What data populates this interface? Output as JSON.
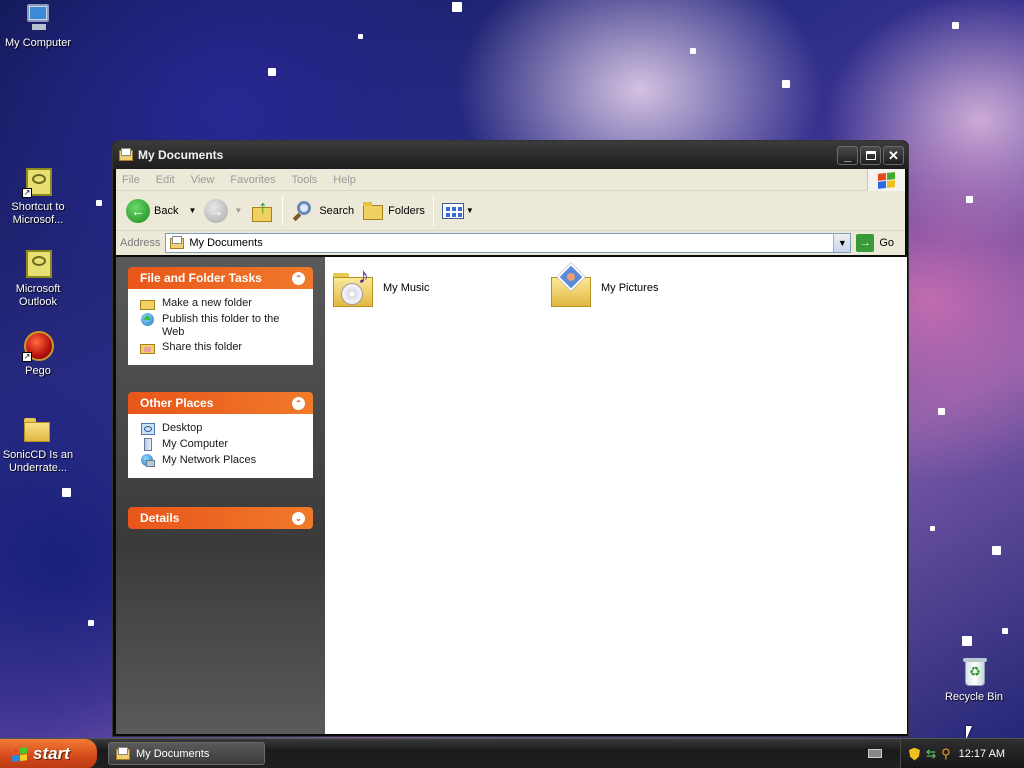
{
  "desktop": {
    "icons": [
      {
        "label": "My Computer",
        "icon": "my-computer-icon"
      },
      {
        "label": "Shortcut to Microsof...",
        "icon": "outlook-shortcut-icon"
      },
      {
        "label": "Microsoft Outlook",
        "icon": "outlook-icon"
      },
      {
        "label": "Pego",
        "icon": "pego-icon"
      },
      {
        "label": "SonicCD Is an Underrate...",
        "icon": "folder-icon"
      },
      {
        "label": "Recycle Bin",
        "icon": "recycle-bin-icon"
      }
    ]
  },
  "window": {
    "title": "My Documents",
    "menu": [
      "File",
      "Edit",
      "View",
      "Favorites",
      "Tools",
      "Help"
    ],
    "toolbar": {
      "back": "Back",
      "search": "Search",
      "folders": "Folders"
    },
    "address": {
      "label": "Address",
      "value": "My Documents",
      "go": "Go"
    },
    "tasks": {
      "file_folder": {
        "title": "File and Folder Tasks",
        "items": [
          "Make a new folder",
          "Publish this folder to the Web",
          "Share this folder"
        ]
      },
      "other_places": {
        "title": "Other Places",
        "items": [
          "Desktop",
          "My Computer",
          "My Network Places"
        ]
      },
      "details": {
        "title": "Details"
      }
    },
    "folders": [
      {
        "name": "My Music",
        "icon": "music-folder-icon"
      },
      {
        "name": "My Pictures",
        "icon": "pictures-folder-icon"
      }
    ]
  },
  "taskbar": {
    "start": "start",
    "items": [
      "My Documents"
    ],
    "clock": "12:17 AM"
  },
  "colors": {
    "panel_header": "#e8561a",
    "taskbar": "#1a1a1a",
    "start": "#d3481a"
  }
}
